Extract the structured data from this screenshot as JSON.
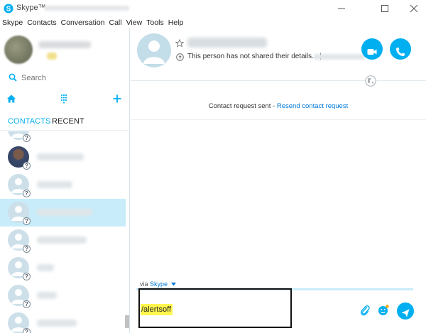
{
  "window": {
    "title": "Skype™ -",
    "controls": [
      "minimize",
      "maximize",
      "close"
    ]
  },
  "menu": [
    "Skype",
    "Contacts",
    "Conversation",
    "Call",
    "View",
    "Tools",
    "Help"
  ],
  "sidebar": {
    "search_placeholder": "Search",
    "tabs": [
      {
        "label": "CONTACTS",
        "active": true
      },
      {
        "label": "RECENT",
        "active": false
      }
    ],
    "contacts": [
      {
        "avatar": "placeholder",
        "status": "?",
        "selected": false
      },
      {
        "avatar": "photo",
        "status": "?",
        "selected": false
      },
      {
        "avatar": "placeholder",
        "status": "?",
        "selected": false
      },
      {
        "avatar": "placeholder",
        "status": "?",
        "selected": true
      },
      {
        "avatar": "placeholder",
        "status": "?",
        "selected": false
      },
      {
        "avatar": "placeholder",
        "status": "?",
        "selected": false
      },
      {
        "avatar": "placeholder",
        "status": "?",
        "selected": false
      },
      {
        "avatar": "placeholder",
        "status": "?",
        "selected": false
      }
    ]
  },
  "conversation": {
    "status_text": "This person has not shared their details...  |",
    "request_text": "Contact request sent - ",
    "resend_link": "Resend contact request",
    "via_label": "via ",
    "via_service": "Skype",
    "message_input": "/alertsoff"
  },
  "colors": {
    "accent": "#00aff0",
    "link": "#0078d7",
    "selected_row": "#c8ecfa",
    "highlight": "#fff64f"
  }
}
